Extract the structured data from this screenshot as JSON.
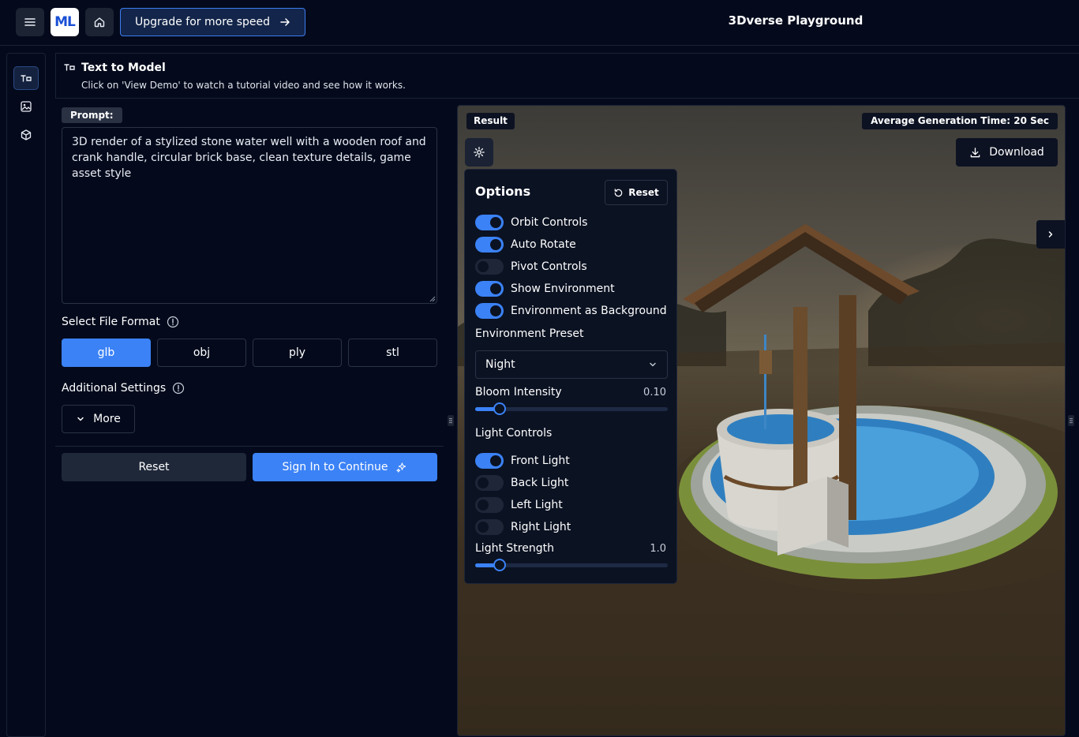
{
  "topbar": {
    "logo_text": "ML",
    "upgrade_label": "Upgrade for more speed",
    "app_title": "3Dverse Playground"
  },
  "header": {
    "title": "Text to Model",
    "subtitle": "Click on 'View Demo' to watch a tutorial video and see how it works."
  },
  "form": {
    "prompt_label": "Prompt:",
    "prompt_value": "3D render of a stylized stone water well with a wooden roof and crank handle, circular brick base, clean texture details, game asset style",
    "file_format_label": "Select File Format",
    "formats": [
      "glb",
      "obj",
      "ply",
      "stl"
    ],
    "selected_format": "glb",
    "additional_settings_label": "Additional Settings",
    "more_label": "More",
    "reset_label": "Reset",
    "signin_label": "Sign In to Continue"
  },
  "viewer": {
    "result_label": "Result",
    "avg_time_label": "Average Generation Time: 20 Sec",
    "download_label": "Download"
  },
  "options": {
    "title": "Options",
    "reset_label": "Reset",
    "toggles": [
      {
        "label": "Orbit Controls",
        "on": true
      },
      {
        "label": "Auto Rotate",
        "on": true
      },
      {
        "label": "Pivot Controls",
        "on": false
      },
      {
        "label": "Show Environment",
        "on": true
      },
      {
        "label": "Environment as Background",
        "on": true
      }
    ],
    "env_preset_label": "Environment Preset",
    "env_preset_value": "Night",
    "bloom_label": "Bloom Intensity",
    "bloom_value": "0.10",
    "bloom_fraction": 0.125,
    "light_controls_label": "Light Controls",
    "lights": [
      {
        "label": "Front Light",
        "on": true
      },
      {
        "label": "Back Light",
        "on": false
      },
      {
        "label": "Left Light",
        "on": false
      },
      {
        "label": "Right Light",
        "on": false
      }
    ],
    "light_strength_label": "Light Strength",
    "light_strength_value": "1.0",
    "light_strength_fraction": 0.125
  },
  "colors": {
    "accent": "#3b82f6",
    "background": "#040a1c"
  }
}
